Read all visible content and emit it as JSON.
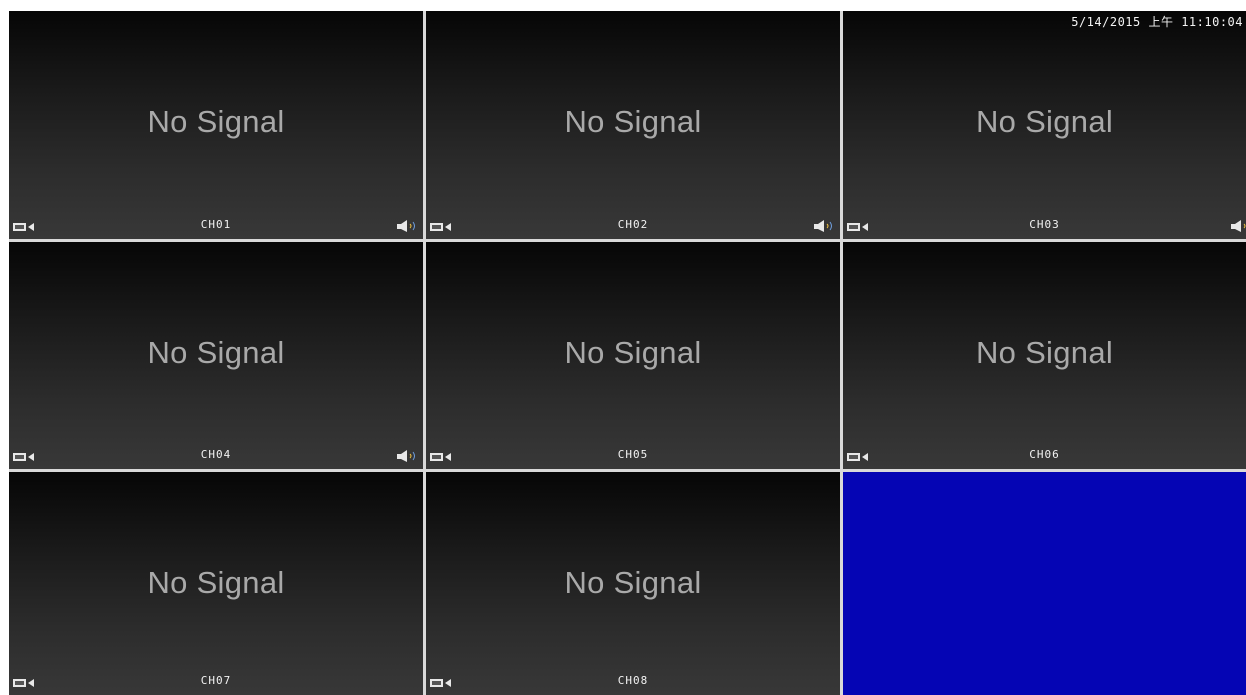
{
  "datetime": "5/14/2015 上午 11:10:04",
  "no_signal_text": "No Signal",
  "channels": [
    {
      "label": "CH01"
    },
    {
      "label": "CH02"
    },
    {
      "label": "CH03"
    },
    {
      "label": "CH04"
    },
    {
      "label": "CH05"
    },
    {
      "label": "CH06"
    },
    {
      "label": "CH07"
    },
    {
      "label": "CH08"
    }
  ],
  "icons": {
    "record": "camera-record-icon",
    "audio": "speaker-icon"
  },
  "colors": {
    "empty_tile": "#0505b4",
    "no_signal_text": "#a9a9a9",
    "grid_divider": "#d9d9d9"
  }
}
